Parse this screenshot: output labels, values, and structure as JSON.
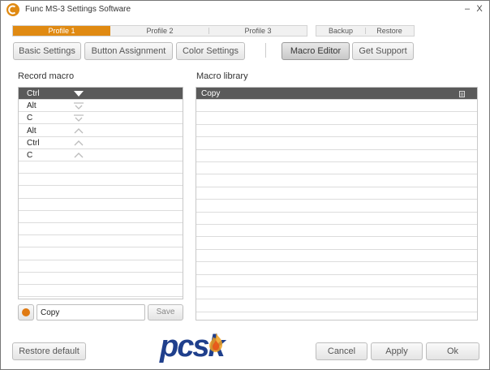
{
  "window": {
    "title": "Func MS-3 Settings Software",
    "minimize": "–",
    "close": "X"
  },
  "profiles": {
    "tabs": [
      {
        "label": "Profile 1",
        "active": true
      },
      {
        "label": "Profile 2",
        "active": false
      },
      {
        "label": "Profile 3",
        "active": false
      }
    ],
    "backup": "Backup",
    "restore": "Restore"
  },
  "nav": {
    "basic_settings": "Basic Settings",
    "button_assignment": "Button Assignment",
    "color_settings": "Color Settings",
    "macro_editor": "Macro Editor",
    "get_support": "Get Support",
    "active": "Macro Editor"
  },
  "record": {
    "label": "Record macro",
    "rows": [
      {
        "key": "Ctrl",
        "action": "press"
      },
      {
        "key": "Alt",
        "action": "press"
      },
      {
        "key": "C",
        "action": "press"
      },
      {
        "key": "Alt",
        "action": "release"
      },
      {
        "key": "Ctrl",
        "action": "release"
      },
      {
        "key": "C",
        "action": "release"
      }
    ],
    "macro_name": "Copy",
    "save": "Save"
  },
  "library": {
    "label": "Macro library",
    "rows": [
      "Copy"
    ]
  },
  "footer": {
    "restore_default": "Restore default",
    "cancel": "Cancel",
    "apply": "Apply",
    "ok": "Ok",
    "logo": "pcsk"
  },
  "colors": {
    "accent": "#e08a12",
    "selected_row": "#5a5a5a",
    "logo_blue": "#1f3f8c"
  }
}
